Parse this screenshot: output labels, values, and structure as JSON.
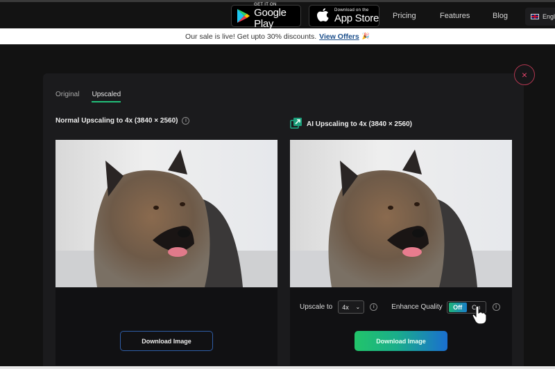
{
  "header": {
    "google_play": {
      "small": "GET IT ON",
      "big": "Google Play"
    },
    "app_store": {
      "small": "Download on the",
      "big": "App Store"
    },
    "nav": [
      "Pricing",
      "Features",
      "Blog"
    ],
    "language": "English"
  },
  "banner": {
    "text": "Our sale is live! Get upto 30% discounts.",
    "link": "View Offers",
    "emoji": "🎉"
  },
  "modal": {
    "tabs": [
      {
        "label": "Original",
        "active": false
      },
      {
        "label": "Upscaled",
        "active": true
      }
    ],
    "left": {
      "heading": "Normal Upscaling to 4x (3840 × 2560)",
      "download_label": "Download Image"
    },
    "right": {
      "heading": "AI Upscaling to 4x (3840 × 2560)",
      "upscale_label": "Upscale to",
      "upscale_value": "4x",
      "enhance_label": "Enhance Quality",
      "toggle_off": "Off",
      "toggle_on": "On",
      "toggle_state": "Off",
      "download_label": "Download Image"
    },
    "close_icon": "×"
  },
  "colors": {
    "accent_green": "#22c07a",
    "accent_blue": "#1a6fd0",
    "close_red": "#e0436a",
    "link_blue": "#1a4d8a"
  }
}
